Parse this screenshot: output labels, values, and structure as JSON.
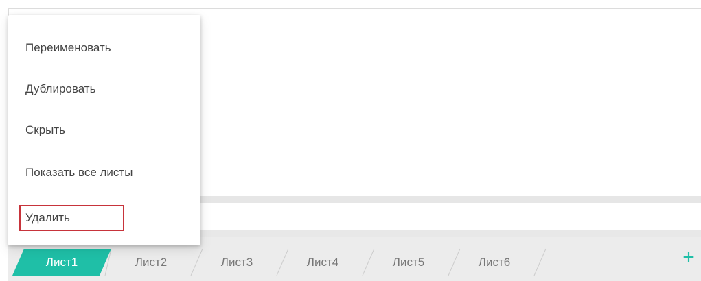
{
  "context_menu": {
    "items": [
      {
        "label": "Переименовать"
      },
      {
        "label": "Дублировать"
      },
      {
        "label": "Скрыть"
      },
      {
        "label": "Показать все листы"
      },
      {
        "label": "Удалить"
      }
    ],
    "highlighted_item": "Удалить",
    "highlight_color": "#c7343b"
  },
  "sheet_tabs": {
    "tabs": [
      {
        "label": "Лист1",
        "active": true
      },
      {
        "label": "Лист2",
        "active": false
      },
      {
        "label": "Лист3",
        "active": false
      },
      {
        "label": "Лист4",
        "active": false
      },
      {
        "label": "Лист5",
        "active": false
      },
      {
        "label": "Лист6",
        "active": false
      }
    ],
    "active_color": "#1fbfa7",
    "add_sheet_label": "+",
    "add_sheet_icon": "plus-icon"
  }
}
